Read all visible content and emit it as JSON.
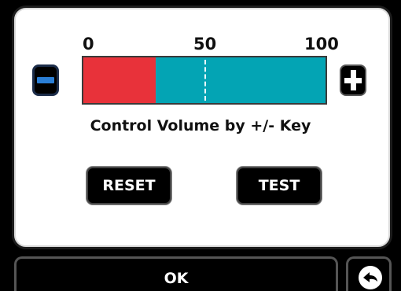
{
  "volume": {
    "scale_min": "0",
    "scale_mid": "50",
    "scale_max": "100",
    "level_percent": 30,
    "fill_color": "#e8323a",
    "track_color": "#03a4b4",
    "caption": "Control Volume by +/- Key",
    "decrease_icon": "minus-icon",
    "increase_icon": "plus-icon"
  },
  "actions": {
    "reset_label": "RESET",
    "test_label": "TEST"
  },
  "footer": {
    "ok_label": "OK",
    "back_icon": "back-arrow-icon"
  }
}
